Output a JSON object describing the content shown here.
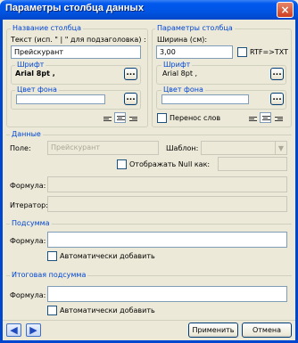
{
  "window": {
    "title": "Параметры столбца данных",
    "close_glyph": "×"
  },
  "column_name": {
    "legend": "Название столбца",
    "text_label": "Текст (исп. \" | \" для подзаголовка) :",
    "text_value": "Прейскурант",
    "font_legend": "Шрифт",
    "font_value": "Arial 8pt ,",
    "bg_legend": "Цвет фона",
    "browse_glyph": "..."
  },
  "column_params": {
    "legend": "Параметры столбца",
    "width_label": "Ширина (см):",
    "width_value": "3,00",
    "rtf_label": "RTF=>TXT",
    "font_legend": "Шрифт",
    "font_value": "Arial 8pt ,",
    "bg_legend": "Цвет фона",
    "wrap_label": "Перенос слов",
    "browse_glyph": "..."
  },
  "data": {
    "legend": "Данные",
    "field_label": "Поле:",
    "field_value": "Прейскурант",
    "template_label": "Шаблон:",
    "template_value": "",
    "null_label": "Отображать Null как:",
    "null_value": "",
    "formula_label": "Формула:",
    "formula_value": "",
    "iterator_label": "Итератор:",
    "iterator_value": ""
  },
  "subtotal": {
    "legend": "Подсумма",
    "formula_label": "Формула:",
    "formula_value": "",
    "auto_label": "Автоматически добавить"
  },
  "total": {
    "legend": "Итоговая подсумма",
    "formula_label": "Формула:",
    "formula_value": "",
    "auto_label": "Автоматически добавить"
  },
  "footer": {
    "apply_label": "Применить",
    "cancel_label": "Отмена",
    "prev_glyph": "◀",
    "next_glyph": "▶"
  },
  "icons": [
    "close-icon",
    "align-left-icon",
    "align-center-icon",
    "align-right-icon",
    "chevron-down-icon",
    "arrow-left-icon",
    "arrow-right-icon"
  ],
  "colors": {
    "titlebar": "#0054e3",
    "dialog_bg": "#ece9d8",
    "group_legend": "#0046d5",
    "input_border": "#7f9db9"
  }
}
